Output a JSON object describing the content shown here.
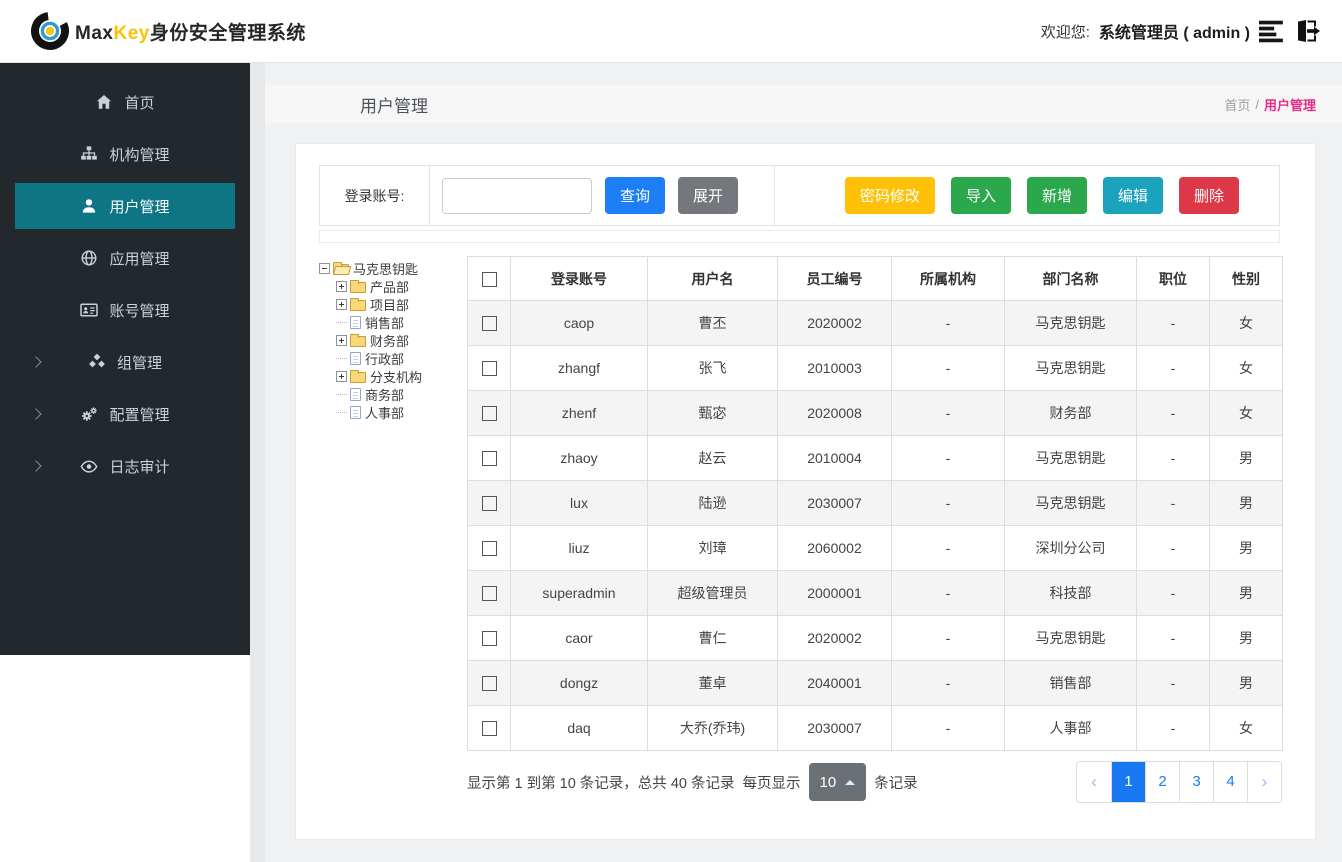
{
  "header": {
    "brand": {
      "max": "Max",
      "key": "Key",
      "suffix": "身份安全管理系统"
    },
    "welcome_label": "欢迎您:",
    "user_label": "系统管理员 ( admin )"
  },
  "sidebar": {
    "items": [
      {
        "label": "首页",
        "icon": "home",
        "active": false,
        "expandable": false
      },
      {
        "label": "机构管理",
        "icon": "sitemap",
        "active": false,
        "expandable": false
      },
      {
        "label": "用户管理",
        "icon": "user",
        "active": true,
        "expandable": false
      },
      {
        "label": "应用管理",
        "icon": "globe",
        "active": false,
        "expandable": false
      },
      {
        "label": "账号管理",
        "icon": "id-card",
        "active": false,
        "expandable": false
      },
      {
        "label": "组管理",
        "icon": "cubes",
        "active": false,
        "expandable": true
      },
      {
        "label": "配置管理",
        "icon": "gears",
        "active": false,
        "expandable": true
      },
      {
        "label": "日志审计",
        "icon": "eye",
        "active": false,
        "expandable": true
      }
    ]
  },
  "page": {
    "title": "用户管理",
    "breadcrumb": {
      "home": "首页",
      "sep": "/",
      "current": "用户管理"
    }
  },
  "search": {
    "label": "登录账号:",
    "input_value": "",
    "query_label": "查询",
    "expand_label": "展开",
    "actions": [
      {
        "label": "密码修改",
        "color": "#fec107"
      },
      {
        "label": "导入",
        "color": "#2aa84b"
      },
      {
        "label": "新增",
        "color": "#2aa84b"
      },
      {
        "label": "编辑",
        "color": "#1ba2bc"
      },
      {
        "label": "删除",
        "color": "#dc3848"
      }
    ]
  },
  "tree": {
    "nodes": [
      {
        "label": "马克思钥匙",
        "level": 0,
        "expander": "minus",
        "icon": "folder-open"
      },
      {
        "label": "产品部",
        "level": 1,
        "expander": "plus",
        "icon": "folder"
      },
      {
        "label": "项目部",
        "level": 1,
        "expander": "plus",
        "icon": "folder"
      },
      {
        "label": "销售部",
        "level": 1,
        "expander": "none",
        "icon": "file"
      },
      {
        "label": "财务部",
        "level": 1,
        "expander": "plus",
        "icon": "folder"
      },
      {
        "label": "行政部",
        "level": 1,
        "expander": "none",
        "icon": "file"
      },
      {
        "label": "分支机构",
        "level": 1,
        "expander": "plus",
        "icon": "folder"
      },
      {
        "label": "商务部",
        "level": 1,
        "expander": "none",
        "icon": "file"
      },
      {
        "label": "人事部",
        "level": 1,
        "expander": "none",
        "icon": "file"
      }
    ]
  },
  "table": {
    "columns": [
      "登录账号",
      "用户名",
      "员工编号",
      "所属机构",
      "部门名称",
      "职位",
      "性别"
    ],
    "rows": [
      {
        "login": "caop",
        "name": "曹丕",
        "emp": "2020002",
        "org": "-",
        "dept": "马克思钥匙",
        "pos": "-",
        "gender": "女"
      },
      {
        "login": "zhangf",
        "name": "张飞",
        "emp": "2010003",
        "org": "-",
        "dept": "马克思钥匙",
        "pos": "-",
        "gender": "女"
      },
      {
        "login": "zhenf",
        "name": "甄宓",
        "emp": "2020008",
        "org": "-",
        "dept": "财务部",
        "pos": "-",
        "gender": "女"
      },
      {
        "login": "zhaoy",
        "name": "赵云",
        "emp": "2010004",
        "org": "-",
        "dept": "马克思钥匙",
        "pos": "-",
        "gender": "男"
      },
      {
        "login": "lux",
        "name": "陆逊",
        "emp": "2030007",
        "org": "-",
        "dept": "马克思钥匙",
        "pos": "-",
        "gender": "男"
      },
      {
        "login": "liuz",
        "name": "刘璋",
        "emp": "2060002",
        "org": "-",
        "dept": "深圳分公司",
        "pos": "-",
        "gender": "男"
      },
      {
        "login": "superadmin",
        "name": "超级管理员",
        "emp": "2000001",
        "org": "-",
        "dept": "科技部",
        "pos": "-",
        "gender": "男"
      },
      {
        "login": "caor",
        "name": "曹仁",
        "emp": "2020002",
        "org": "-",
        "dept": "马克思钥匙",
        "pos": "-",
        "gender": "男"
      },
      {
        "login": "dongz",
        "name": "董卓",
        "emp": "2040001",
        "org": "-",
        "dept": "销售部",
        "pos": "-",
        "gender": "男"
      },
      {
        "login": "daq",
        "name": "大乔(乔玮)",
        "emp": "2030007",
        "org": "-",
        "dept": "人事部",
        "pos": "-",
        "gender": "女"
      }
    ]
  },
  "pagination": {
    "info_prefix": "显示第 1 到第 10 条记录，总共 40 条记录",
    "per_page_label": "每页显示",
    "page_size": "10",
    "info_suffix": "条记录",
    "prev": "‹",
    "next": "›",
    "pages": [
      {
        "label": "1",
        "active": true
      },
      {
        "label": "2",
        "active": false
      },
      {
        "label": "3",
        "active": false
      },
      {
        "label": "4",
        "active": false
      }
    ]
  },
  "colors": {
    "sidebar_dark": "#23282d",
    "active_menu_teal": "#0e7585",
    "brand_yellow": "#fdc300",
    "accent_blue": "#1e7ef5",
    "pagination_active_blue": "#1778f2",
    "breadcrumb_active_pink": "#e62d87",
    "warning_yellow": "#fec107",
    "success_green": "#2aa84b",
    "info_teal": "#1ba2bc",
    "danger_red": "#dc3848"
  }
}
